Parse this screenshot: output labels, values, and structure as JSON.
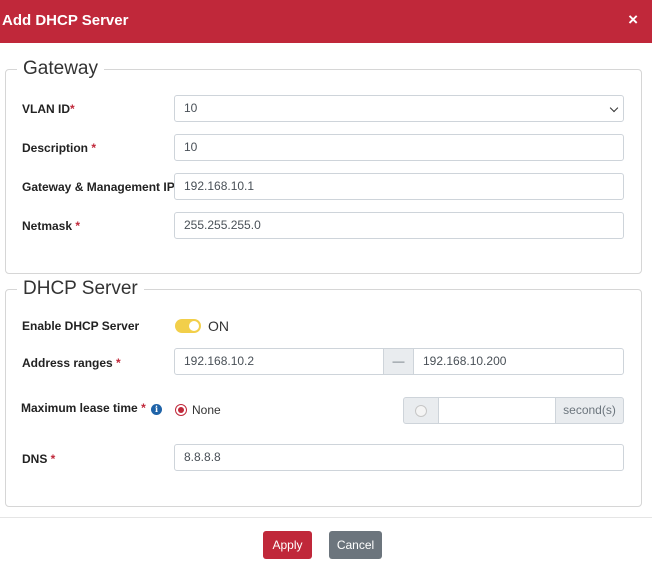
{
  "dialog": {
    "title": "Add DHCP Server",
    "close_glyph": "×"
  },
  "gateway": {
    "legend": "Gateway",
    "vlan": {
      "label": "VLAN ID",
      "required": "*",
      "value": "10"
    },
    "description": {
      "label": "Description ",
      "required": "*",
      "value": "10"
    },
    "gateway_ip": {
      "label": "Gateway & Management IP",
      "value": "192.168.10.1"
    },
    "netmask": {
      "label": "Netmask ",
      "required": "*",
      "value": "255.255.255.0"
    }
  },
  "dhcp": {
    "legend": "DHCP Server",
    "enable": {
      "label": "Enable DHCP Server",
      "state": "ON",
      "toggle_color": "#f2cf4a"
    },
    "address_ranges": {
      "label": "Address ranges ",
      "required": "*",
      "start": "192.168.10.2",
      "separator": "—",
      "end": "192.168.10.200"
    },
    "lease_time": {
      "label": "Maximum lease time ",
      "required": "*",
      "info_glyph": "i",
      "none_label": "None",
      "value": "",
      "unit": "second(s)"
    },
    "dns": {
      "label": "DNS ",
      "required": "*",
      "value": "8.8.8.8"
    }
  },
  "footer": {
    "apply_label": "Apply",
    "cancel_label": "Cancel"
  },
  "colors": {
    "brand": "#c0283a",
    "cancel": "#6c757d",
    "info": "#1f63a8"
  }
}
